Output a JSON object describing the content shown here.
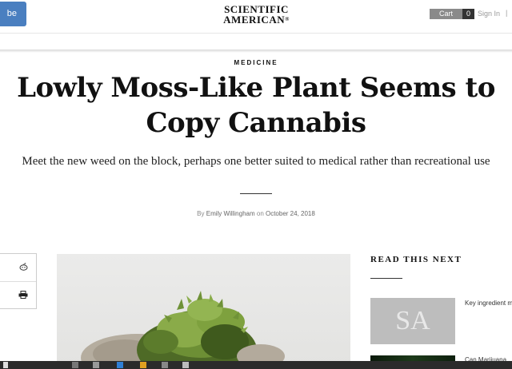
{
  "header": {
    "subscribe_label": "be",
    "logo_line1": "SCIENTIFIC",
    "logo_line2": "AMERICAN",
    "logo_mark": "®",
    "cart_label": "Cart",
    "cart_count": "0",
    "signin_label": "Sign In",
    "separator": "|"
  },
  "article": {
    "section": "MEDICINE",
    "headline": "Lowly Moss-Like Plant Seems to Copy Cannabis",
    "dek": "Meet the new weed on the block, perhaps one better suited to medical rather than recreational use",
    "byline_prefix": "By ",
    "author": "Emily Willingham",
    "byline_on": " on ",
    "date": "October 24, 2018"
  },
  "share": {
    "icons": [
      "reddit-icon",
      "print-icon"
    ]
  },
  "read_next": {
    "heading": "READ THIS NEXT",
    "items": [
      {
        "thumb_text": "SA",
        "title": "Key ingredient marijuana mer"
      },
      {
        "title": "Can Marijuana"
      }
    ]
  },
  "colors": {
    "subscribe_bg": "#4a7fc0",
    "cart_bg": "#8a8a8a",
    "cart_count_bg": "#333333",
    "taskbar_bg": "#2b2b2b"
  }
}
